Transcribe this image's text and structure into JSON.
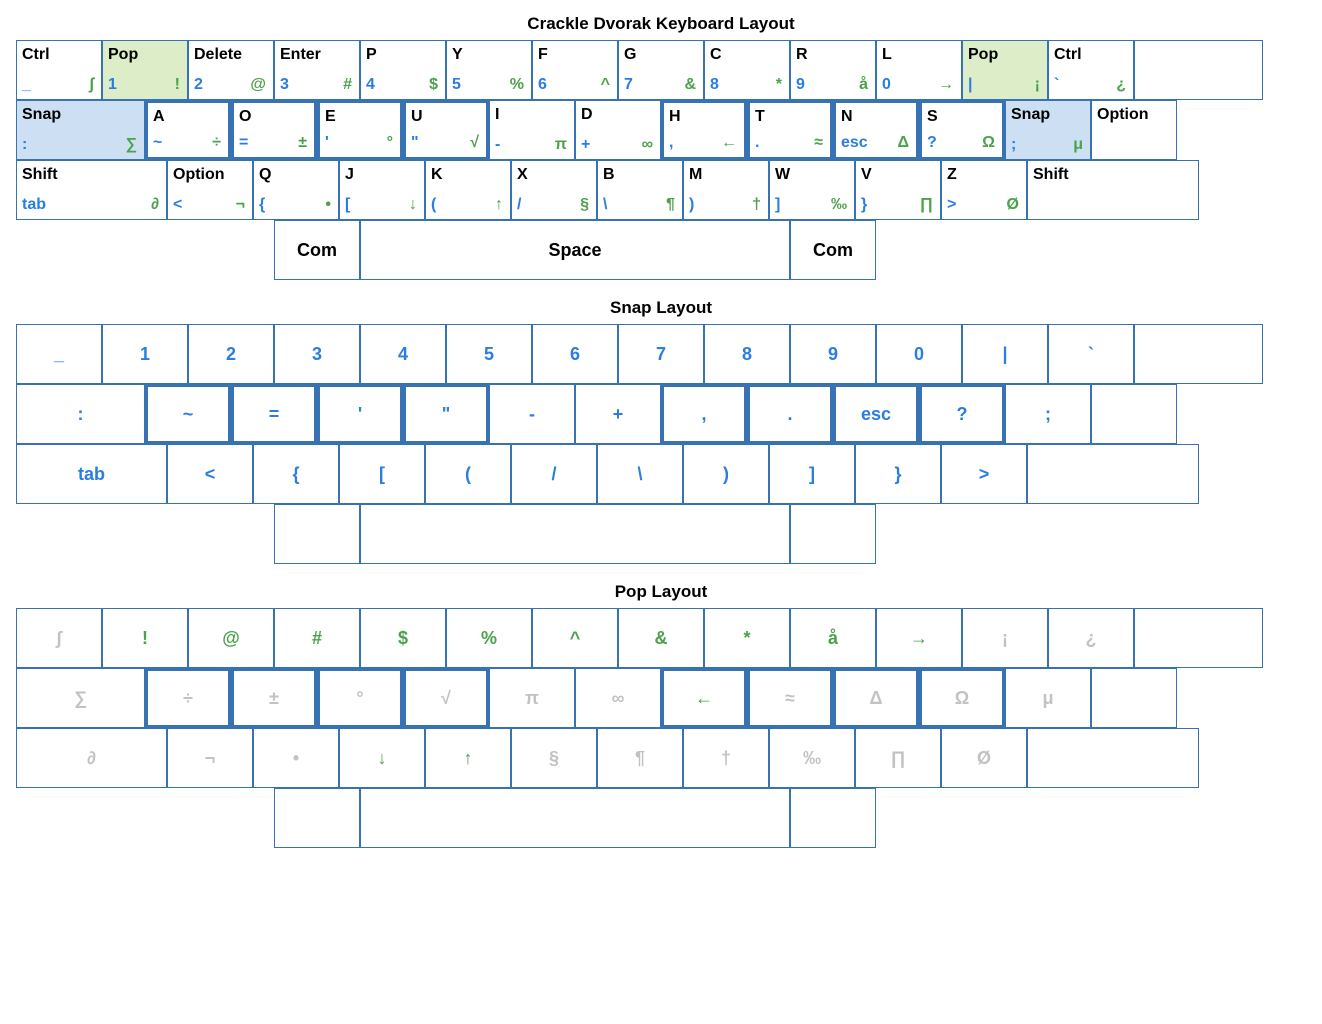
{
  "sections": {
    "main": {
      "title": "Crackle Dvorak Keyboard Layout"
    },
    "snap": {
      "title": "Snap Layout"
    },
    "pop": {
      "title": "Pop Layout"
    }
  },
  "main_layout": {
    "row1": [
      {
        "w": "w1",
        "tl": "Ctrl",
        "bl": "_",
        "br": "∫"
      },
      {
        "w": "w1",
        "tl": "Pop",
        "bl": "1",
        "br": "!",
        "bg": "green"
      },
      {
        "w": "w1",
        "tl": "Delete",
        "bl": "2",
        "br": "@"
      },
      {
        "w": "w1",
        "tl": "Enter",
        "bl": "3",
        "br": "#"
      },
      {
        "w": "w1",
        "tl": "P",
        "bl": "4",
        "br": "$"
      },
      {
        "w": "w1",
        "tl": "Y",
        "bl": "5",
        "br": "%"
      },
      {
        "w": "w1",
        "tl": "F",
        "bl": "6",
        "br": "^"
      },
      {
        "w": "w1",
        "tl": "G",
        "bl": "7",
        "br": "&"
      },
      {
        "w": "w1",
        "tl": "C",
        "bl": "8",
        "br": "*"
      },
      {
        "w": "w1",
        "tl": "R",
        "bl": "9",
        "br": "å"
      },
      {
        "w": "w1",
        "tl": "L",
        "bl": "0",
        "br": "→"
      },
      {
        "w": "w1",
        "tl": "Pop",
        "bl": "|",
        "br": "¡",
        "bg": "green"
      },
      {
        "w": "w1",
        "tl": "Ctrl",
        "bl": "`",
        "br": "¿"
      },
      {
        "w": "w15",
        "tl": "",
        "bl": "",
        "br": ""
      }
    ],
    "row2": [
      {
        "w": "w15",
        "tl": "Snap",
        "bl": ":",
        "br": "∑",
        "bg": "blue"
      },
      {
        "w": "w1",
        "tl": "A",
        "bl": "~",
        "br": "÷",
        "home": true
      },
      {
        "w": "w1",
        "tl": "O",
        "bl": "=",
        "br": "±",
        "home": true
      },
      {
        "w": "w1",
        "tl": "E",
        "bl": "'",
        "br": "°",
        "home": true
      },
      {
        "w": "w1",
        "tl": "U",
        "bl": "\"",
        "br": "√",
        "home": true
      },
      {
        "w": "w1",
        "tl": "I",
        "bl": "-",
        "br": "π"
      },
      {
        "w": "w1",
        "tl": "D",
        "bl": "+",
        "br": "∞"
      },
      {
        "w": "w1",
        "tl": "H",
        "bl": ",",
        "br": "←",
        "home": true
      },
      {
        "w": "w1",
        "tl": "T",
        "bl": ".",
        "br": "≈",
        "home": true
      },
      {
        "w": "w1",
        "tl": "N",
        "bl": "esc",
        "br": "Δ",
        "home": true
      },
      {
        "w": "w1",
        "tl": "S",
        "bl": "?",
        "br": "Ω",
        "home": true
      },
      {
        "w": "w1",
        "tl": "Snap",
        "bl": ";",
        "br": "μ",
        "bg": "blue"
      },
      {
        "w": "w1",
        "tl": "Option",
        "bl": "",
        "br": ""
      }
    ],
    "row3": [
      {
        "w": "w175",
        "tl": "Shift",
        "bl": "tab",
        "br": "∂"
      },
      {
        "w": "w1",
        "tl": "Option",
        "bl": "<",
        "br": "¬"
      },
      {
        "w": "w1",
        "tl": "Q",
        "bl": "{",
        "br": "•"
      },
      {
        "w": "w1",
        "tl": "J",
        "bl": "[",
        "br": "↓"
      },
      {
        "w": "w1",
        "tl": "K",
        "bl": "(",
        "br": "↑"
      },
      {
        "w": "w1",
        "tl": "X",
        "bl": "/",
        "br": "§"
      },
      {
        "w": "w1",
        "tl": "B",
        "bl": "\\",
        "br": "¶"
      },
      {
        "w": "w1",
        "tl": "M",
        "bl": ")",
        "br": "†"
      },
      {
        "w": "w1",
        "tl": "W",
        "bl": "]",
        "br": "‰"
      },
      {
        "w": "w1",
        "tl": "V",
        "bl": "}",
        "br": "∏"
      },
      {
        "w": "w1",
        "tl": "Z",
        "bl": ">",
        "br": "Ø"
      },
      {
        "w": "w2",
        "tl": "Shift",
        "bl": "",
        "br": ""
      }
    ],
    "row4": [
      {
        "w": "w1",
        "tl": "",
        "bl": "",
        "br": "",
        "ctr": "Com",
        "ctrcolor": "black"
      },
      {
        "w": "w5",
        "tl": "",
        "bl": "",
        "br": "",
        "ctr": "Space",
        "ctrcolor": "black"
      },
      {
        "w": "w1",
        "tl": "",
        "bl": "",
        "br": "",
        "ctr": "Com",
        "ctrcolor": "black"
      }
    ]
  },
  "snap_layout": {
    "color": "blue",
    "row1": [
      {
        "w": "w1",
        "ctr": "_"
      },
      {
        "w": "w1",
        "ctr": "1"
      },
      {
        "w": "w1",
        "ctr": "2"
      },
      {
        "w": "w1",
        "ctr": "3"
      },
      {
        "w": "w1",
        "ctr": "4"
      },
      {
        "w": "w1",
        "ctr": "5"
      },
      {
        "w": "w1",
        "ctr": "6"
      },
      {
        "w": "w1",
        "ctr": "7"
      },
      {
        "w": "w1",
        "ctr": "8"
      },
      {
        "w": "w1",
        "ctr": "9"
      },
      {
        "w": "w1",
        "ctr": "0"
      },
      {
        "w": "w1",
        "ctr": "|"
      },
      {
        "w": "w1",
        "ctr": "`"
      },
      {
        "w": "w15",
        "ctr": ""
      }
    ],
    "row2": [
      {
        "w": "w15",
        "ctr": ":"
      },
      {
        "w": "w1",
        "ctr": "~",
        "home": true
      },
      {
        "w": "w1",
        "ctr": "=",
        "home": true
      },
      {
        "w": "w1",
        "ctr": "'",
        "home": true
      },
      {
        "w": "w1",
        "ctr": "\"",
        "home": true
      },
      {
        "w": "w1",
        "ctr": "-"
      },
      {
        "w": "w1",
        "ctr": "+"
      },
      {
        "w": "w1",
        "ctr": ",",
        "home": true
      },
      {
        "w": "w1",
        "ctr": ".",
        "home": true
      },
      {
        "w": "w1",
        "ctr": "esc",
        "home": true
      },
      {
        "w": "w1",
        "ctr": "?",
        "home": true
      },
      {
        "w": "w1",
        "ctr": ";"
      },
      {
        "w": "w1",
        "ctr": ""
      }
    ],
    "row3": [
      {
        "w": "w175",
        "ctr": "tab"
      },
      {
        "w": "w1",
        "ctr": "<"
      },
      {
        "w": "w1",
        "ctr": "{"
      },
      {
        "w": "w1",
        "ctr": "["
      },
      {
        "w": "w1",
        "ctr": "("
      },
      {
        "w": "w1",
        "ctr": "/"
      },
      {
        "w": "w1",
        "ctr": "\\"
      },
      {
        "w": "w1",
        "ctr": ")"
      },
      {
        "w": "w1",
        "ctr": "]"
      },
      {
        "w": "w1",
        "ctr": "}"
      },
      {
        "w": "w1",
        "ctr": ">"
      },
      {
        "w": "w2",
        "ctr": ""
      }
    ],
    "row4": [
      {
        "w": "w1",
        "ctr": ""
      },
      {
        "w": "w5",
        "ctr": ""
      },
      {
        "w": "w1",
        "ctr": ""
      }
    ]
  },
  "pop_layout": {
    "row1": [
      {
        "w": "w1",
        "ctr": "∫",
        "c": "grey"
      },
      {
        "w": "w1",
        "ctr": "!",
        "c": "green"
      },
      {
        "w": "w1",
        "ctr": "@",
        "c": "green"
      },
      {
        "w": "w1",
        "ctr": "#",
        "c": "green"
      },
      {
        "w": "w1",
        "ctr": "$",
        "c": "green"
      },
      {
        "w": "w1",
        "ctr": "%",
        "c": "green"
      },
      {
        "w": "w1",
        "ctr": "^",
        "c": "green"
      },
      {
        "w": "w1",
        "ctr": "&",
        "c": "green"
      },
      {
        "w": "w1",
        "ctr": "*",
        "c": "green"
      },
      {
        "w": "w1",
        "ctr": "å",
        "c": "green"
      },
      {
        "w": "w1",
        "ctr": "→",
        "c": "green"
      },
      {
        "w": "w1",
        "ctr": "¡",
        "c": "grey"
      },
      {
        "w": "w1",
        "ctr": "¿",
        "c": "grey"
      },
      {
        "w": "w15",
        "ctr": ""
      }
    ],
    "row2": [
      {
        "w": "w15",
        "ctr": "∑",
        "c": "grey"
      },
      {
        "w": "w1",
        "ctr": "÷",
        "c": "grey",
        "home": true
      },
      {
        "w": "w1",
        "ctr": "±",
        "c": "grey",
        "home": true
      },
      {
        "w": "w1",
        "ctr": "°",
        "c": "grey",
        "home": true
      },
      {
        "w": "w1",
        "ctr": "√",
        "c": "grey",
        "home": true
      },
      {
        "w": "w1",
        "ctr": "π",
        "c": "grey"
      },
      {
        "w": "w1",
        "ctr": "∞",
        "c": "grey"
      },
      {
        "w": "w1",
        "ctr": "←",
        "c": "green",
        "home": true
      },
      {
        "w": "w1",
        "ctr": "≈",
        "c": "grey",
        "home": true
      },
      {
        "w": "w1",
        "ctr": "Δ",
        "c": "grey",
        "home": true
      },
      {
        "w": "w1",
        "ctr": "Ω",
        "c": "grey",
        "home": true
      },
      {
        "w": "w1",
        "ctr": "μ",
        "c": "grey"
      },
      {
        "w": "w1",
        "ctr": ""
      }
    ],
    "row3": [
      {
        "w": "w175",
        "ctr": "∂",
        "c": "grey"
      },
      {
        "w": "w1",
        "ctr": "¬",
        "c": "grey"
      },
      {
        "w": "w1",
        "ctr": "•",
        "c": "grey"
      },
      {
        "w": "w1",
        "ctr": "↓",
        "c": "green"
      },
      {
        "w": "w1",
        "ctr": "↑",
        "c": "green"
      },
      {
        "w": "w1",
        "ctr": "§",
        "c": "grey"
      },
      {
        "w": "w1",
        "ctr": "¶",
        "c": "grey"
      },
      {
        "w": "w1",
        "ctr": "†",
        "c": "grey"
      },
      {
        "w": "w1",
        "ctr": "‰",
        "c": "grey"
      },
      {
        "w": "w1",
        "ctr": "∏",
        "c": "grey"
      },
      {
        "w": "w1",
        "ctr": "Ø",
        "c": "grey"
      },
      {
        "w": "w2",
        "ctr": ""
      }
    ],
    "row4": [
      {
        "w": "w1",
        "ctr": ""
      },
      {
        "w": "w5",
        "ctr": ""
      },
      {
        "w": "w1",
        "ctr": ""
      }
    ]
  }
}
